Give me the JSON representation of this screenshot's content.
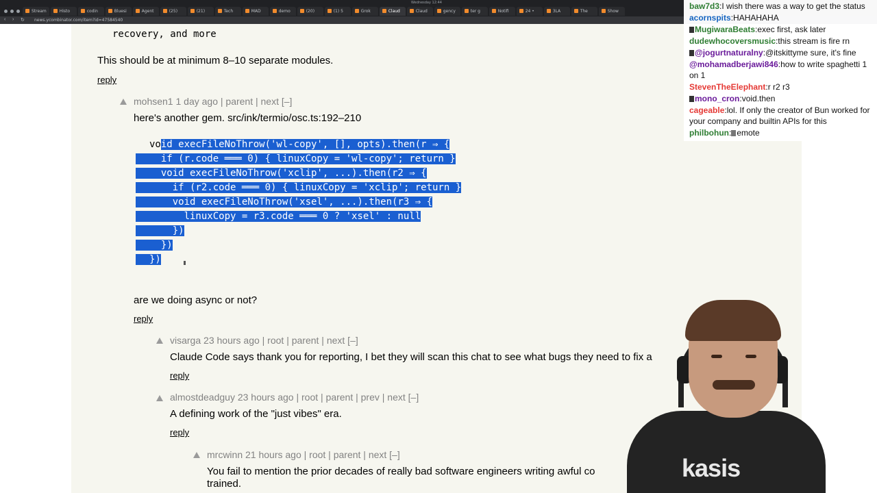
{
  "browser": {
    "window_title": "Wednesday 12:44",
    "tabs": [
      "Stream",
      "Histo",
      "codin",
      "Bluesi",
      "Agent",
      "(25)",
      "(21)",
      "Tech",
      "MAD",
      "demo",
      "(20)",
      "(1) 5",
      "Grok",
      "Claud",
      "Claud",
      "gency",
      "ter g",
      "Notifi",
      "24 •",
      "3LA",
      "The",
      "Show"
    ],
    "active_tab_index": 13,
    "url": "news.ycombinator.com/item?id=47584540"
  },
  "page": {
    "top_line": "recovery, and more",
    "modules_line": "This should be at minimum 8–10 separate modules.",
    "reply": "reply",
    "comments": [
      {
        "user": "mohsen1",
        "age": "1 day ago",
        "links": "| parent | next [–]",
        "text": "here's another gem. src/ink/termio/osc.ts:192–210"
      },
      {
        "text": "are we doing async or not?"
      },
      {
        "user": "visarga",
        "age": "23 hours ago",
        "links": "| root | parent | next [–]",
        "text": "Claude Code says thank you for reporting, I bet they will scan this chat to see what bugs they need to fix a"
      },
      {
        "user": "almostdeadguy",
        "age": "23 hours ago",
        "links": "| root | parent | prev | next [–]",
        "text": "A defining work of the \"just vibes\" era."
      },
      {
        "user": "mrcwinn",
        "age": "21 hours ago",
        "links": "| root | parent | next [–]",
        "text": "You fail to mention the prior decades of really bad software engineers writing awful co",
        "text_cont": "trained."
      }
    ],
    "code_lines": [
      {
        "plain": "vo",
        "selected": "id execFileNoThrow('wl-copy', [], opts).then(r ⇒ {"
      },
      {
        "plain": "",
        "selected": "  if (r.code ═══ 0) { linuxCopy = 'wl-copy'; return }"
      },
      {
        "plain": "",
        "selected": "  void execFileNoThrow('xclip', ...).then(r2 ⇒ {"
      },
      {
        "plain": "",
        "selected": "    if (r2.code ═══ 0) { linuxCopy = 'xclip'; return }"
      },
      {
        "plain": "",
        "selected": "    void execFileNoThrow('xsel', ...).then(r3 ⇒ {"
      },
      {
        "plain": "",
        "selected": "      linuxCopy = r3.code ═══ 0 ? 'xsel' : null"
      },
      {
        "plain": "",
        "selected": "    })"
      },
      {
        "plain": "",
        "selected": "  })"
      },
      {
        "plain": "",
        "selected": "})"
      }
    ]
  },
  "chat": {
    "messages": [
      {
        "user": "baw7d3",
        "color": "#2e7d32",
        "text": "I wish there was a way to get the status",
        "badge": false
      },
      {
        "user": "acornspits",
        "color": "#1565c0",
        "text": "HAHAHAHA",
        "badge": false
      },
      {
        "user": "MugiwaraBeats",
        "color": "#2e7d32",
        "text": "exec first, ask later",
        "badge": true
      },
      {
        "user": "dudewhocoversmusic",
        "color": "#2e7d32",
        "text": "this stream is fire rn",
        "badge": false
      },
      {
        "user": "@jogurtnaturalny",
        "color": "#6a1b9a",
        "text": "@itskittyme sure, it's fine",
        "badge": true
      },
      {
        "user": "@mohamadberjawi846",
        "color": "#6a1b9a",
        "text": "how to write spaghetti 1 on 1",
        "badge": false
      },
      {
        "user": "StevenTheElephant",
        "color": "#e53935",
        "text": "r r2 r3",
        "badge": false
      },
      {
        "user": "mono_cron",
        "color": "#6a1b9a",
        "text": "void.then",
        "badge": true
      },
      {
        "user": "cageable",
        "color": "#e53935",
        "text": "lol. If only the creator of Bun worked for your company and builtin APIs for this",
        "badge": false
      },
      {
        "user": "philbohun",
        "color": "#2e7d32",
        "text": "emote",
        "badge": false,
        "emote": true
      }
    ]
  },
  "webcam": {
    "shirt_text": "kasis"
  }
}
